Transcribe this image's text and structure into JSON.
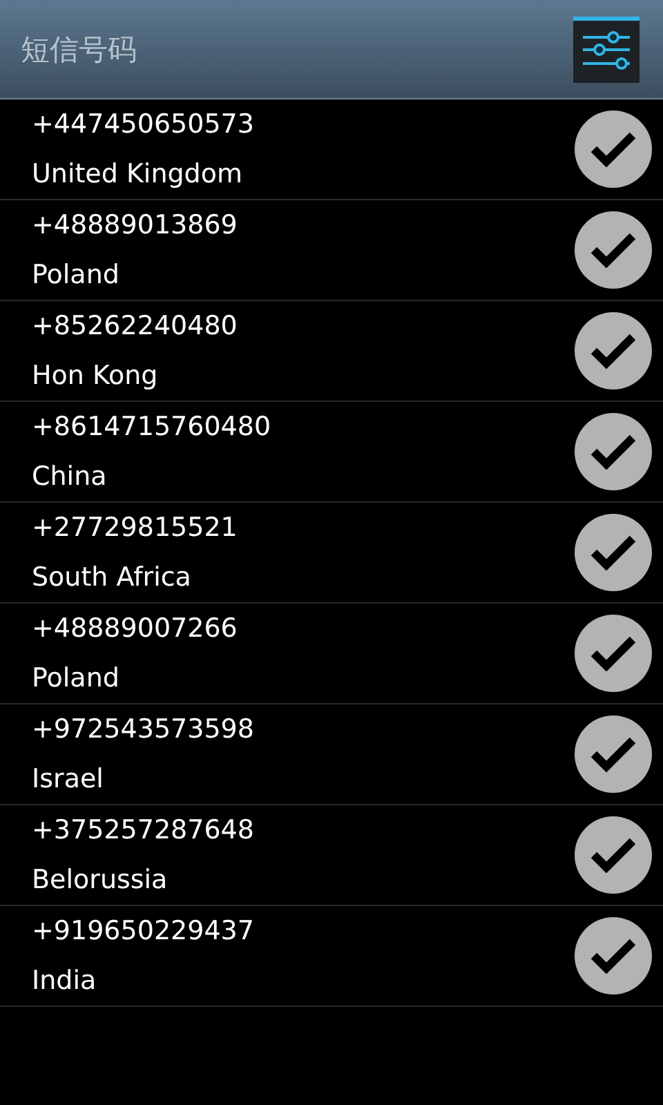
{
  "header": {
    "title": "短信号码"
  },
  "numbers": [
    {
      "number": "+447450650573",
      "country": "United Kingdom",
      "checked": true
    },
    {
      "number": "+48889013869",
      "country": "Poland",
      "checked": true
    },
    {
      "number": "+85262240480",
      "country": "Hon Kong",
      "checked": true
    },
    {
      "number": "+8614715760480",
      "country": "China",
      "checked": true
    },
    {
      "number": "+27729815521",
      "country": "South Africa",
      "checked": true
    },
    {
      "number": "+48889007266",
      "country": "Poland",
      "checked": true
    },
    {
      "number": "+972543573598",
      "country": "Israel",
      "checked": true
    },
    {
      "number": "+375257287648",
      "country": "Belorussia",
      "checked": true
    },
    {
      "number": "+919650229437",
      "country": "India",
      "checked": true
    }
  ]
}
